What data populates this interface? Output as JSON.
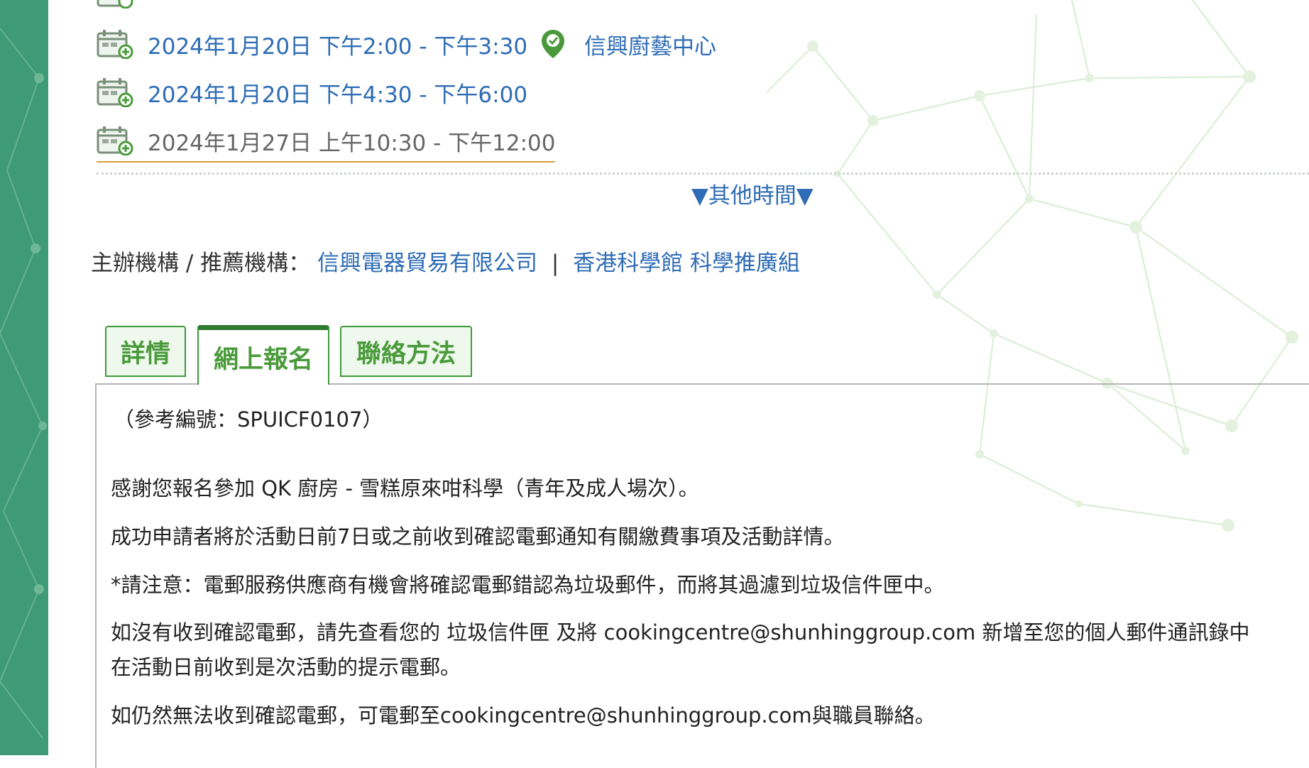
{
  "sessions": [
    {
      "date_time": "2024年1月20日 下午2:00 - 下午3:30",
      "location": "信興廚藝中心"
    },
    {
      "date_time": "2024年1月20日 下午4:30 - 下午6:00"
    },
    {
      "date_time": "2024年1月27日 上午10:30 - 下午12:00"
    }
  ],
  "more_times_label": "▼其他時間▼",
  "organizer": {
    "label": "主辦機構 / 推薦機構：",
    "org1": "信興電器貿易有限公司",
    "separator": "|",
    "org2": "香港科學館 科學推廣組"
  },
  "tabs": {
    "details": "詳情",
    "online_registration": "網上報名",
    "contact": "聯絡方法"
  },
  "content": {
    "reference": "（參考編號：SPUICF0107）",
    "line1": "感謝您報名參加 QK 廚房 - 雪糕原來咁科學（青年及成人場次）。",
    "line2": "成功申請者將於活動日前7日或之前收到確認電郵通知有關繳費事項及活動詳情。",
    "line3": "*請注意：電郵服務供應商有機會將確認電郵錯認為垃圾郵件，而將其過濾到垃圾信件匣中。",
    "line4a": "如沒有收到確認電郵，請先查看您的 垃圾信件匣 及將 cookingcentre@shunhinggroup.com 新增至您的個人郵件通訊錄中",
    "line4b": "在活動日前收到是次活動的提示電郵。",
    "line5": "如仍然無法收到確認電郵，可電郵至cookingcentre@shunhinggroup.com與職員聯絡。"
  },
  "colors": {
    "link": "#2e6cb5",
    "tab_green": "#3d9a3a",
    "side_band": "#3f9a78"
  }
}
